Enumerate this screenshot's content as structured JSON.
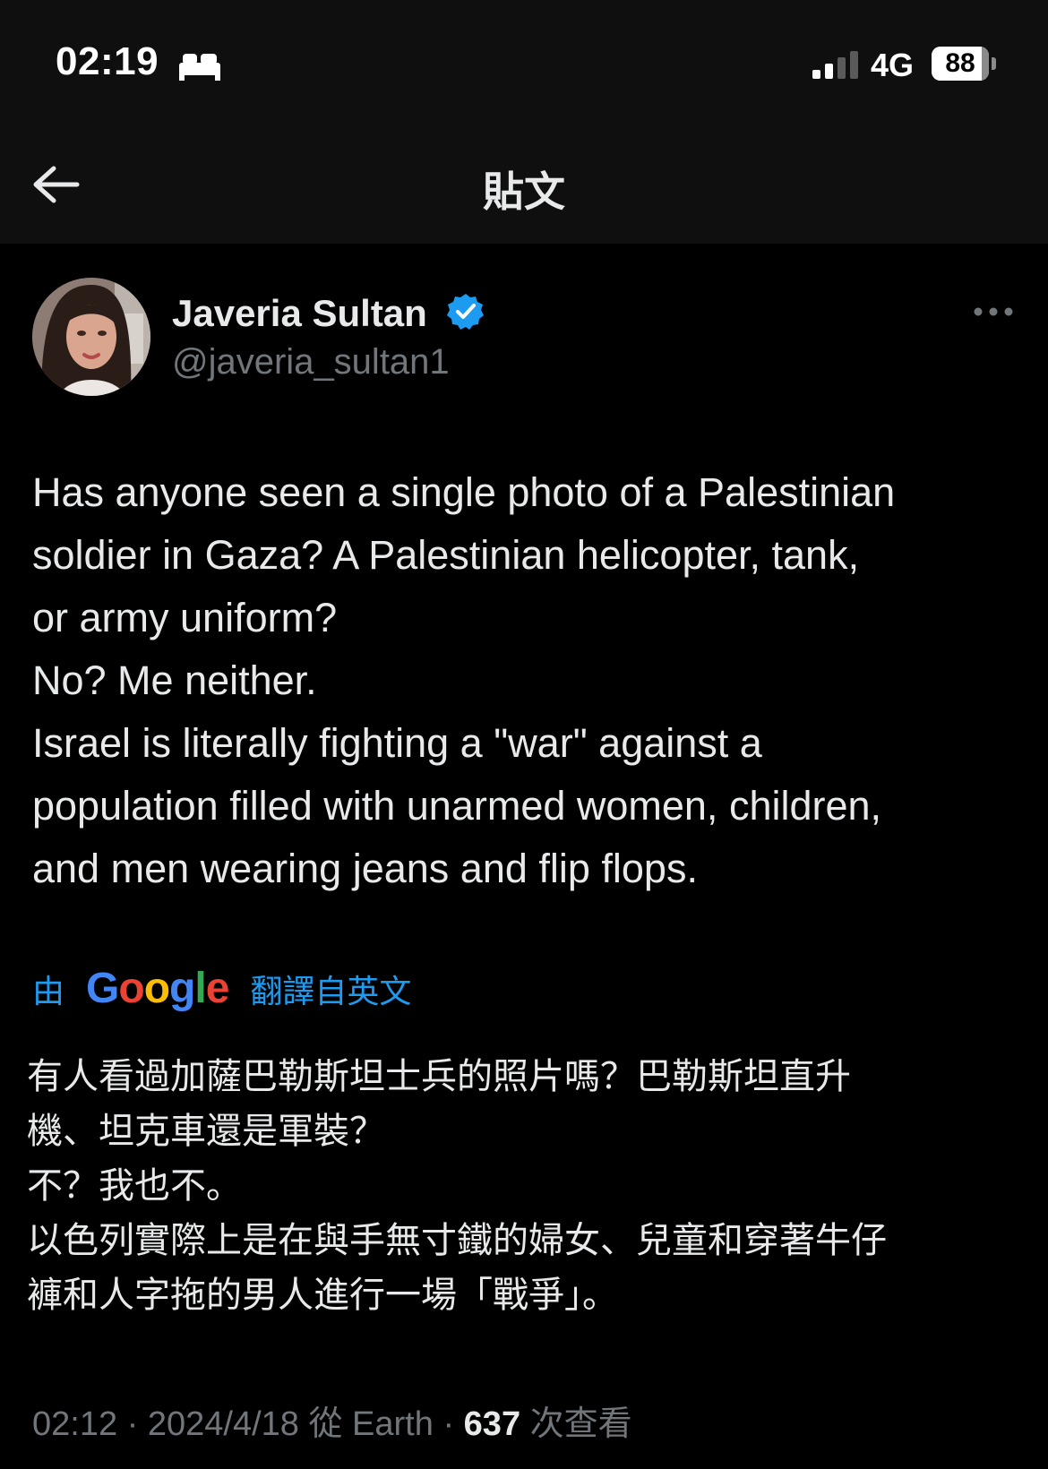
{
  "status_bar": {
    "time": "02:19",
    "network": "4G",
    "battery": "88",
    "battery_level_percent": 88,
    "signal_bars_active": 2,
    "signal_bars_total": 4
  },
  "header": {
    "title": "貼文"
  },
  "author": {
    "display_name": "Javeria Sultan",
    "handle": "@javeria_sultan1",
    "verified": true
  },
  "tweet": {
    "lines": [
      "Has anyone seen a single photo of a Palestinian",
      "soldier in Gaza? A Palestinian helicopter, tank,",
      "or army uniform?",
      "No? Me neither.",
      "Israel is literally fighting a \"war\" against a",
      "population filled with unarmed women, children,",
      "and men wearing jeans and flip flops."
    ]
  },
  "translation": {
    "prefix": "由",
    "provider": "Google",
    "suffix": "翻譯自英文",
    "lines": [
      "有人看過加薩巴勒斯坦士兵的照片嗎？巴勒斯坦直升",
      "機、坦克車還是軍裝？",
      "不？我也不。",
      "以色列實際上是在與手無寸鐵的婦女、兒童和穿著牛仔",
      "褲和人字拖的男人進行一場「戰爭」。"
    ]
  },
  "meta": {
    "time": "02:12",
    "separator": " · ",
    "date": "2024/4/18",
    "source": " 從 Earth",
    "views": "637",
    "views_label": " 次查看"
  },
  "colors": {
    "background": "#000000",
    "text": "#e7e9ea",
    "muted": "#71767b",
    "accent": "#1d9bf0"
  },
  "icons": {
    "back": "arrow-left-icon",
    "verified": "verified-badge-icon",
    "more": "more-dots-icon",
    "bed": "bed-icon",
    "signal": "cellular-signal-icon"
  }
}
